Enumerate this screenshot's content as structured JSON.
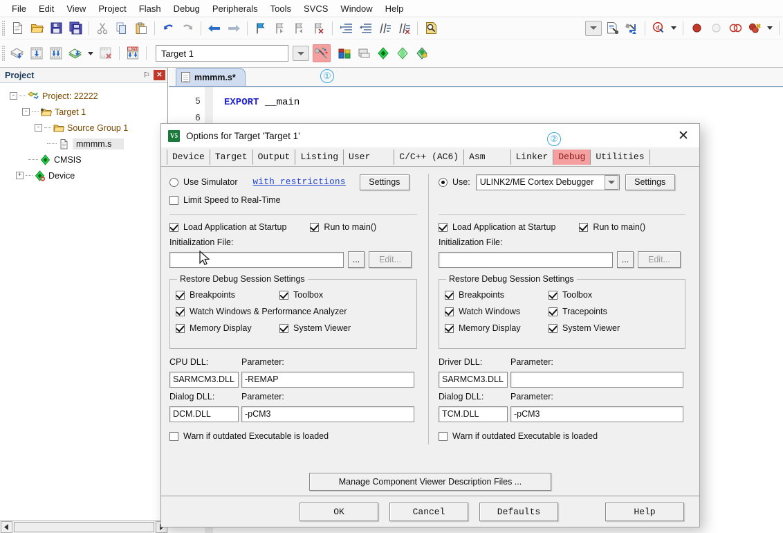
{
  "menubar": {
    "items": [
      "File",
      "Edit",
      "View",
      "Project",
      "Flash",
      "Debug",
      "Peripherals",
      "Tools",
      "SVCS",
      "Window",
      "Help"
    ]
  },
  "toolbar": {
    "row1_icons": [
      "new-file-icon",
      "open-file-icon",
      "save-icon",
      "save-all-icon",
      "cut-icon",
      "copy-icon",
      "paste-icon",
      "undo-icon",
      "redo-icon",
      "navigate-back-icon",
      "navigate-forward-icon",
      "bookmark-toggle-icon",
      "bookmark-prev-icon",
      "bookmark-next-icon",
      "bookmark-clear-icon",
      "indent-icon",
      "outdent-icon",
      "comment-icon",
      "uncomment-icon",
      "find-in-files-icon"
    ],
    "row2_icons": [
      "translate-icon",
      "build-icon",
      "rebuild-icon",
      "batch-build-icon",
      "stop-build-icon",
      "download-icon"
    ],
    "right_icons": [
      "configure-target-dropdown-icon",
      "options-for-target-icon",
      "manage-runtime-env-icon",
      "start-debug-icon",
      "insert-breakpoint-icon",
      "disable-breakpoint-icon",
      "disable-all-breakpoints-icon",
      "kill-all-breakpoints-icon"
    ],
    "target_value": "Target 1"
  },
  "project_panel": {
    "title": "Project",
    "pin_label": "⚐",
    "close_label": "✕",
    "tree": [
      {
        "label": "Project: 22222",
        "icon": "project-icon",
        "expander": "-",
        "depth": 0,
        "selected": false
      },
      {
        "label": "Target 1",
        "icon": "target-folder-icon",
        "expander": "-",
        "depth": 1,
        "selected": false
      },
      {
        "label": "Source Group 1",
        "icon": "folder-icon",
        "expander": "-",
        "depth": 2,
        "selected": false
      },
      {
        "label": "mmmm.s",
        "icon": "source-file-icon",
        "expander": "",
        "depth": 3,
        "selected": true
      },
      {
        "label": "CMSIS",
        "icon": "cmsis-icon",
        "expander": "",
        "depth": 2,
        "selected": false
      },
      {
        "label": "Device",
        "icon": "device-icon",
        "expander": "+",
        "depth": 2,
        "selected": false
      }
    ]
  },
  "editor": {
    "tab_label": "mmmm.s*",
    "annotation_1": "①",
    "lines": [
      {
        "number": "5",
        "keyword": "EXPORT",
        "rest": " __main"
      },
      {
        "number": "6",
        "keyword": "",
        "rest": ""
      }
    ]
  },
  "dialog": {
    "title": "Options for Target 'Target 1'",
    "icon_label": "V5",
    "close_label": "✕",
    "annotation_2": "②",
    "tabs": [
      {
        "label": "Device",
        "active": false
      },
      {
        "label": "Target",
        "active": false
      },
      {
        "label": "Output",
        "active": false
      },
      {
        "label": "Listing",
        "active": false
      },
      {
        "label": "User",
        "active": false
      },
      {
        "label": "C/C++ (AC6)",
        "active": false
      },
      {
        "label": "Asm",
        "active": false
      },
      {
        "label": "Linker",
        "active": false
      },
      {
        "label": "Debug",
        "active": true
      },
      {
        "label": "Utilities",
        "active": false
      }
    ],
    "left": {
      "use_simulator_label": "Use Simulator",
      "use_simulator_checked": false,
      "with_restrictions_link": "with restrictions",
      "settings_label": "Settings",
      "limit_speed_label": "Limit Speed to Real-Time",
      "limit_speed_checked": false,
      "load_app_label": "Load Application at Startup",
      "load_app_checked": true,
      "run_to_main_label": "Run to main()",
      "run_to_main_checked": true,
      "init_file_label": "Initialization File:",
      "init_file_value": "",
      "browse_label": "...",
      "edit_label": "Edit...",
      "restore_group_label": "Restore Debug Session Settings",
      "restore_items": [
        {
          "label": "Breakpoints",
          "checked": true
        },
        {
          "label": "Toolbox",
          "checked": true
        },
        {
          "label": "Watch Windows & Performance Analyzer",
          "checked": true
        },
        {
          "label": "Memory Display",
          "checked": true
        },
        {
          "label": "System Viewer",
          "checked": true
        }
      ],
      "dll_label": "CPU DLL:",
      "dll_param_label": "Parameter:",
      "dll_value": "SARMCM3.DLL",
      "dll_param_value": "-REMAP",
      "dialog_dll_label": "Dialog DLL:",
      "dialog_dll_param_label": "Parameter:",
      "dialog_dll_value": "DCM.DLL",
      "dialog_dll_param_value": "-pCM3",
      "warn_label": "Warn if outdated Executable is loaded",
      "warn_checked": false
    },
    "right": {
      "use_label": "Use:",
      "use_checked": true,
      "debugger_value": "ULINK2/ME Cortex Debugger",
      "settings_label": "Settings",
      "load_app_label": "Load Application at Startup",
      "load_app_checked": true,
      "run_to_main_label": "Run to main()",
      "run_to_main_checked": true,
      "init_file_label": "Initialization File:",
      "init_file_value": "",
      "browse_label": "...",
      "edit_label": "Edit...",
      "restore_group_label": "Restore Debug Session Settings",
      "restore_items": [
        {
          "label": "Breakpoints",
          "checked": true
        },
        {
          "label": "Toolbox",
          "checked": true
        },
        {
          "label": "Watch Windows",
          "checked": true
        },
        {
          "label": "Tracepoints",
          "checked": true
        },
        {
          "label": "Memory Display",
          "checked": true
        },
        {
          "label": "System Viewer",
          "checked": true
        }
      ],
      "dll_label": "Driver DLL:",
      "dll_param_label": "Parameter:",
      "dll_value": "SARMCM3.DLL",
      "dll_param_value": "",
      "dialog_dll_label": "Dialog DLL:",
      "dialog_dll_param_label": "Parameter:",
      "dialog_dll_value": "TCM.DLL",
      "dialog_dll_param_value": "-pCM3",
      "warn_label": "Warn if outdated Executable is loaded",
      "warn_checked": false
    },
    "manage_button": "Manage Component Viewer Description Files ...",
    "footer": {
      "ok": "OK",
      "cancel": "Cancel",
      "defaults": "Defaults",
      "help": "Help"
    }
  },
  "colors": {
    "highlight_tab_bg": "#f4a0a0",
    "highlight_tab_fg": "#8b1a1a",
    "annotation": "#3aa8e0",
    "link": "#1a3fd0",
    "keyword": "#2222cc",
    "panel_title": "#1a3a5a"
  }
}
